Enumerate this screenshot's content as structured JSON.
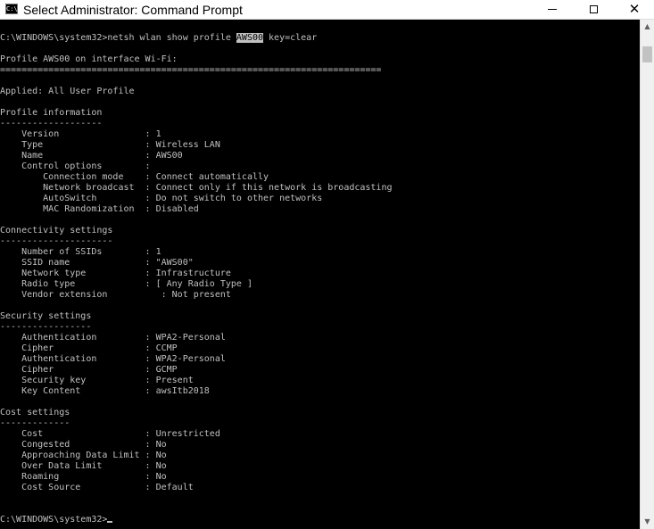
{
  "window": {
    "title": "Select Administrator: Command Prompt",
    "icon_label": "C:\\",
    "minimize_glyph": "",
    "close_glyph": "✕"
  },
  "console": {
    "command": {
      "prefix": "C:\\WINDOWS\\system32>netsh wlan show profile ",
      "highlight": "AWS00",
      "suffix": " key=clear"
    },
    "output_lines": [
      "",
      "Profile AWS00 on interface Wi-Fi:",
      "=======================================================================",
      "",
      "Applied: All User Profile",
      "",
      "Profile information",
      "-------------------",
      "    Version                : 1",
      "    Type                   : Wireless LAN",
      "    Name                   : AWS00",
      "    Control options        :",
      "        Connection mode    : Connect automatically",
      "        Network broadcast  : Connect only if this network is broadcasting",
      "        AutoSwitch         : Do not switch to other networks",
      "        MAC Randomization  : Disabled",
      "",
      "Connectivity settings",
      "---------------------",
      "    Number of SSIDs        : 1",
      "    SSID name              : \"AWS00\"",
      "    Network type           : Infrastructure",
      "    Radio type             : [ Any Radio Type ]",
      "    Vendor extension          : Not present",
      "",
      "Security settings",
      "-----------------",
      "    Authentication         : WPA2-Personal",
      "    Cipher                 : CCMP",
      "    Authentication         : WPA2-Personal",
      "    Cipher                 : GCMP",
      "    Security key           : Present",
      "    Key Content            : awsItb2018",
      "",
      "Cost settings",
      "-------------",
      "    Cost                   : Unrestricted",
      "    Congested              : No",
      "    Approaching Data Limit : No",
      "    Over Data Limit        : No",
      "    Roaming                : No",
      "    Cost Source            : Default",
      "",
      ""
    ],
    "prompt": "C:\\WINDOWS\\system32>"
  },
  "scrollbar": {
    "up_glyph": "▲",
    "down_glyph": "▼"
  },
  "colors": {
    "console_background": "#000000",
    "console_text": "#c0c0c0",
    "selection_background": "#c0c0c0",
    "selection_text": "#000000"
  }
}
